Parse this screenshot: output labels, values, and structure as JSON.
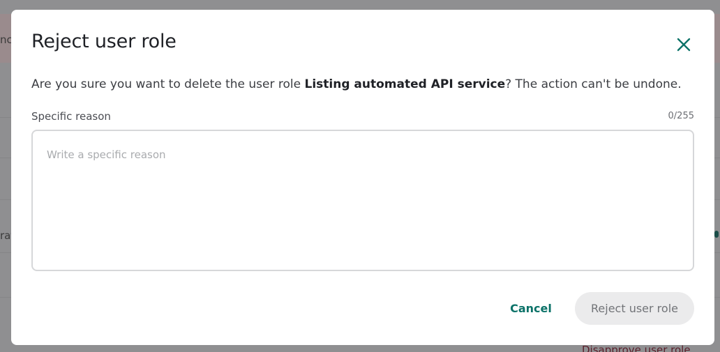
{
  "background": {
    "left_fragment_top": "nc",
    "left_fragment_middle": "rat",
    "bottom_link": "Disapprove user role"
  },
  "modal": {
    "title": "Reject user role",
    "close_icon": "close-icon",
    "description": {
      "before": "Are you sure you want to delete the user role ",
      "role_name": "Listing automated API service",
      "after": "? The action can't be undone."
    },
    "reason_field": {
      "label": "Specific reason",
      "counter": "0/255",
      "value": "",
      "placeholder": "Write a specific reason"
    },
    "actions": {
      "cancel_label": "Cancel",
      "reject_label": "Reject user role"
    }
  },
  "colors": {
    "accent": "#0b7268",
    "overlay": "#8f8f91",
    "disabled_button_bg": "#ebebec",
    "disabled_button_text": "#727478"
  }
}
